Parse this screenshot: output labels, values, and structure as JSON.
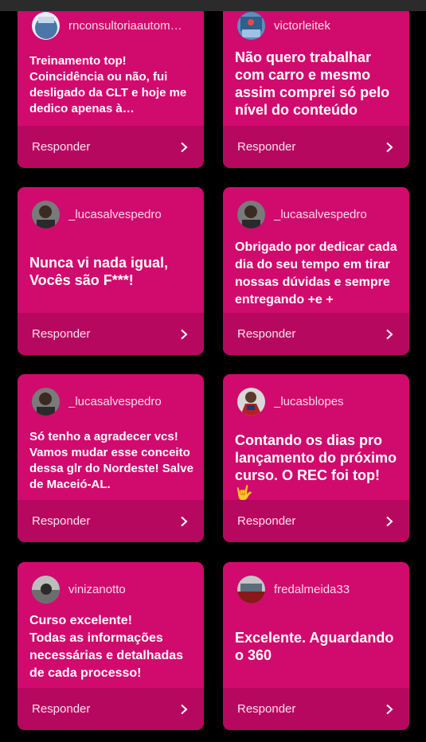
{
  "cards": [
    {
      "username": "rnconsultoriaautom…",
      "message": "Treinamento top!\nCoincidência ou não, fui desligado da CLT e hoje me dedico apenas à…",
      "reply_label": "Responder",
      "avatar": "avatar-icon"
    },
    {
      "username": "victorleitek",
      "message": "Não quero trabalhar com carro e mesmo assim comprei só pelo nível do conteúdo",
      "reply_label": "Responder",
      "avatar": "avatar-icon"
    },
    {
      "username": "_lucasalvespedro",
      "message": "Nunca vi nada igual, Vocês são F***!",
      "reply_label": "Responder",
      "avatar": "avatar-icon"
    },
    {
      "username": "_lucasalvespedro",
      "message": "Obrigado por dedicar cada dia do seu tempo em tirar nossas dúvidas e sempre entregando +e +",
      "reply_label": "Responder",
      "avatar": "avatar-icon"
    },
    {
      "username": "_lucasalvespedro",
      "message": "Só tenho a agradecer vcs! Vamos mudar esse conceito dessa glr do Nordeste! Salve de Maceió-AL.",
      "reply_label": "Responder",
      "avatar": "avatar-icon"
    },
    {
      "username": "_lucasblopes",
      "message": "Contando os dias pro lançamento do próximo curso. O REC foi top! 🤟",
      "reply_label": "Responder",
      "avatar": "avatar-icon"
    },
    {
      "username": "vinizanotto",
      "message": "Curso excelente!\nTodas as informações necessárias e detalhadas de cada processo!",
      "reply_label": "Responder",
      "avatar": "avatar-icon"
    },
    {
      "username": "fredalmeida33",
      "message": "Excelente. Aguardando o 360",
      "reply_label": "Responder",
      "avatar": "avatar-icon"
    }
  ],
  "colors": {
    "card": "#d10a6e",
    "footer": "#b70860",
    "background": "#000000"
  },
  "icons": {
    "chevron": "chevron-right-icon"
  }
}
